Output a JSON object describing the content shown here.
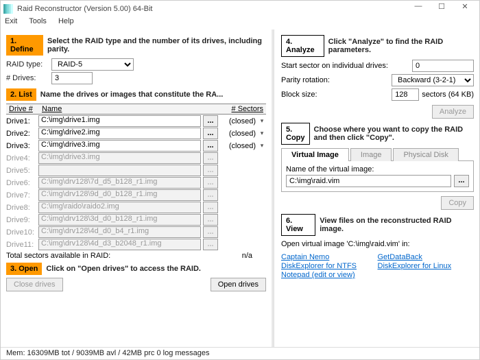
{
  "window": {
    "title": "Raid Reconstructor (Version 5.00) 64-Bit"
  },
  "menu": {
    "exit": "Exit",
    "tools": "Tools",
    "help": "Help"
  },
  "step1": {
    "badge": "1. Define",
    "text": "Select the RAID type and the number of its drives, including parity."
  },
  "raidtype": {
    "label": "RAID type:",
    "value": "RAID-5"
  },
  "drives": {
    "label": "# Drives:",
    "value": "3"
  },
  "step2": {
    "badge": "2. List",
    "text": "Name the drives or images that constitute the RA..."
  },
  "listhead": {
    "num": "Drive #",
    "name": "Name",
    "sect": "# Sectors"
  },
  "drive_rows": [
    {
      "label": "Drive1:",
      "path": "C:\\img\\drive1.img",
      "status": "(closed)",
      "enabled": true
    },
    {
      "label": "Drive2:",
      "path": "C:\\img\\drive2.img",
      "status": "(closed)",
      "enabled": true
    },
    {
      "label": "Drive3:",
      "path": "C:\\img\\drive3.img",
      "status": "(closed)",
      "enabled": true
    },
    {
      "label": "Drive4:",
      "path": "C:\\img\\drive3.img",
      "status": "",
      "enabled": false
    },
    {
      "label": "Drive5:",
      "path": "",
      "status": "",
      "enabled": false
    },
    {
      "label": "Drive6:",
      "path": "C:\\img\\drv128\\7d_d5_b128_r1.img",
      "status": "",
      "enabled": false
    },
    {
      "label": "Drive7:",
      "path": "C:\\img\\drv128\\9d_d0_b128_r1.img",
      "status": "",
      "enabled": false
    },
    {
      "label": "Drive8:",
      "path": "C:\\img\\raido\\raido2.img",
      "status": "",
      "enabled": false
    },
    {
      "label": "Drive9:",
      "path": "C:\\img\\drv128\\3d_d0_b128_r1.img",
      "status": "",
      "enabled": false
    },
    {
      "label": "Drive10:",
      "path": "C:\\img\\drv128\\4d_d0_b4_r1.img",
      "status": "",
      "enabled": false
    },
    {
      "label": "Drive11:",
      "path": "C:\\img\\drv128\\4d_d3_b2048_r1.img",
      "status": "",
      "enabled": false
    }
  ],
  "totals": {
    "label": "Total sectors available in RAID:",
    "value": "n/a"
  },
  "step3": {
    "badge": "3. Open",
    "text": "Click on \"Open drives\" to access the RAID."
  },
  "buttons": {
    "close": "Close drives",
    "open": "Open drives",
    "analyze": "Analyze",
    "copy": "Copy",
    "browse": "..."
  },
  "step4": {
    "badge": "4. Analyze",
    "text": "Click \"Analyze\" to find the RAID parameters."
  },
  "analyze": {
    "start_label": "Start sector on individual drives:",
    "start": "0",
    "parity_label": "Parity rotation:",
    "parity": "Backward (3-2-1)",
    "block_label": "Block size:",
    "block": "128",
    "block_suffix": "sectors (64 KB)"
  },
  "step5": {
    "badge": "5. Copy",
    "text": "Choose where you want to copy the RAID and then click \"Copy\"."
  },
  "tabs": {
    "vi": "Virtual Image",
    "img": "Image",
    "pd": "Physical Disk"
  },
  "vim": {
    "label": "Name of the virtual image:",
    "value": "C:\\img\\raid.vim"
  },
  "step6": {
    "badge": "6. View",
    "text": "View files on the reconstructed RAID image."
  },
  "view_open": "Open virtual image 'C:\\img\\raid.vim' in:",
  "links": {
    "captain": "Captain Nemo",
    "ntfs": "DiskExplorer for NTFS",
    "notepad": "Notepad (edit or view)",
    "gdb": "GetDataBack",
    "linux": "DiskExplorer for Linux"
  },
  "status": "Mem: 16309MB tot / 9039MB avl / 42MB prc  0 log messages"
}
